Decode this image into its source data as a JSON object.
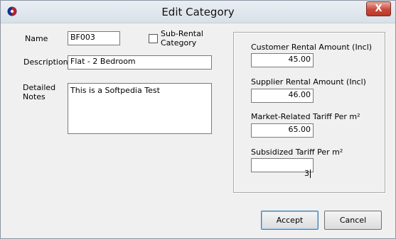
{
  "window": {
    "title": "Edit Category",
    "close_label": "X"
  },
  "form": {
    "name_label": "Name",
    "name_value": "BF003",
    "sub_rental_label_line1": "Sub-Rental",
    "sub_rental_label_line2": "Category",
    "description_label": "Description",
    "description_value": "Flat - 2 Bedroom",
    "notes_label_line1": "Detailed",
    "notes_label_line2": "Notes",
    "notes_value": "This is a Softpedia Test"
  },
  "rates": {
    "customer_label": "Customer Rental Amount (Incl)",
    "customer_value": "45.00",
    "supplier_label": "Supplier Rental Amount (Incl)",
    "supplier_value": "46.00",
    "market_label": "Market-Related Tariff Per m²",
    "market_value": "65.00",
    "subsidized_label": "Subsidized Tariff Per m²",
    "subsidized_value": "3"
  },
  "buttons": {
    "accept": "Accept",
    "cancel": "Cancel"
  }
}
